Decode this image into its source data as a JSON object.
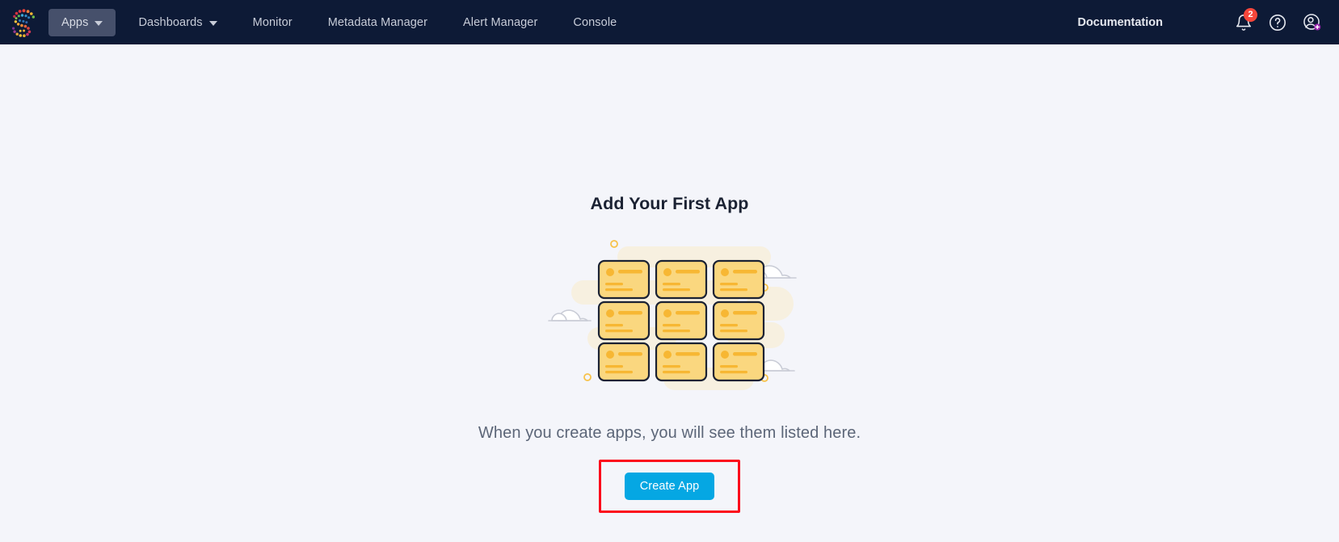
{
  "app": {
    "logo_name": "streamsets-logo",
    "background_color": "#f4f5fa",
    "nav_background_color": "#0d1a36",
    "accent_color": "#05a7e3",
    "highlight_color": "#fc0d1c"
  },
  "nav": {
    "items": [
      {
        "label": "Apps",
        "has_caret": true,
        "active": true
      },
      {
        "label": "Dashboards",
        "has_caret": true,
        "active": false
      },
      {
        "label": "Monitor",
        "has_caret": false,
        "active": false
      },
      {
        "label": "Metadata Manager",
        "has_caret": false,
        "active": false
      },
      {
        "label": "Alert Manager",
        "has_caret": false,
        "active": false
      },
      {
        "label": "Console",
        "has_caret": false,
        "active": false
      }
    ],
    "documentation_label": "Documentation",
    "notifications": {
      "icon": "bell-icon",
      "badge_count": "2",
      "badge_color": "#f5463b"
    },
    "help": {
      "icon": "question-circle-icon"
    },
    "account": {
      "icon": "user-account-icon"
    }
  },
  "main": {
    "title": "Add Your First App",
    "subtitle": "When you create apps, you will see them listed here.",
    "cta_label": "Create App",
    "illustration_name": "empty-apps-illustration",
    "illustration_colors": {
      "card_fill": "#fad77f",
      "card_accent": "#f7b733",
      "card_stroke": "#1b2233",
      "blob": "#f6efdf",
      "cloud": "#ffffff",
      "cloud_stroke": "#c9ccd6",
      "ring": "#f7c24a"
    }
  }
}
